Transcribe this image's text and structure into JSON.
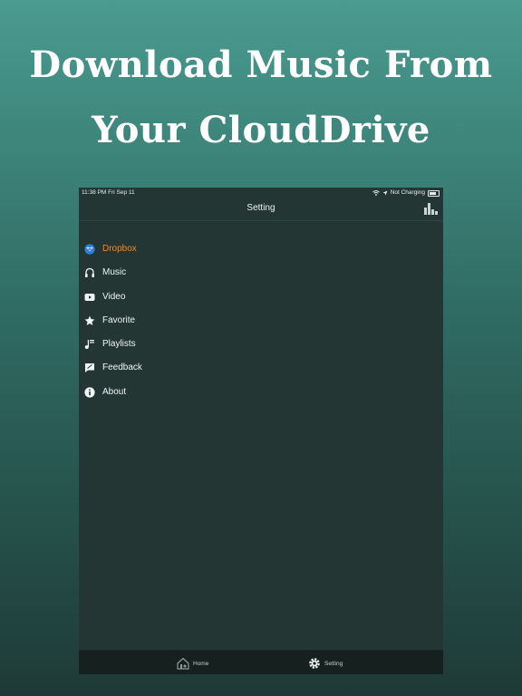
{
  "headline": {
    "line1": "Download Music From",
    "line2": "Your CloudDrive"
  },
  "status_bar": {
    "time_date": "11:38 PM   Fri Sep 11",
    "battery_status": "Not Charging"
  },
  "nav": {
    "title": "Setting"
  },
  "menu": {
    "items": [
      {
        "label": "Dropbox",
        "icon": "dropbox-icon",
        "active": true
      },
      {
        "label": "Music",
        "icon": "headphones-icon"
      },
      {
        "label": "Video",
        "icon": "video-icon"
      },
      {
        "label": "Favorite",
        "icon": "star-icon"
      },
      {
        "label": "Playlists",
        "icon": "playlist-icon"
      },
      {
        "label": "Feedback",
        "icon": "feedback-icon"
      },
      {
        "label": "About",
        "icon": "info-icon"
      }
    ]
  },
  "tabbar": {
    "home_label": "Home",
    "setting_label": "Setting"
  },
  "colors": {
    "active": "#f08a28",
    "dropbox_blue": "#2d7fd8",
    "panel": "#243634"
  }
}
